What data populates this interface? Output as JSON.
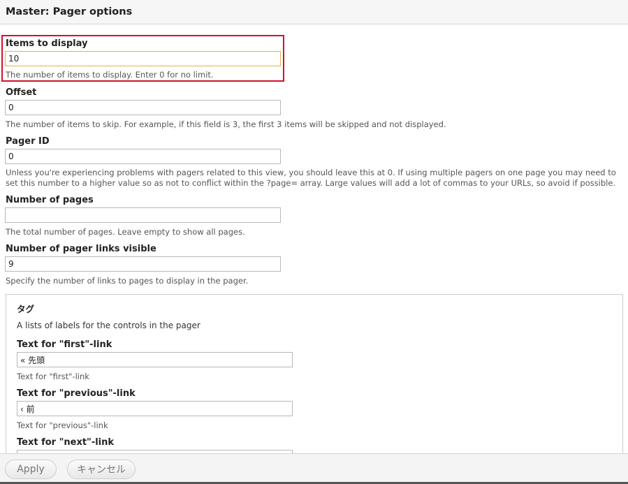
{
  "dialog": {
    "title": "Master: Pager options"
  },
  "fields": {
    "items_to_display": {
      "label": "Items to display",
      "value": "10",
      "description": "The number of items to display. Enter 0 for no limit."
    },
    "offset": {
      "label": "Offset",
      "value": "0",
      "description": "The number of items to skip. For example, if this field is 3, the first 3 items will be skipped and not displayed."
    },
    "pager_id": {
      "label": "Pager ID",
      "value": "0",
      "description": "Unless you're experiencing problems with pagers related to this view, you should leave this at 0. If using multiple pagers on one page you may need to set this number to a higher value so as not to conflict within the ?page= array. Large values will add a lot of commas to your URLs, so avoid if possible."
    },
    "number_of_pages": {
      "label": "Number of pages",
      "value": "",
      "description": "The total number of pages. Leave empty to show all pages."
    },
    "pager_links_visible": {
      "label": "Number of pager links visible",
      "value": "9",
      "description": "Specify the number of links to pages to display in the pager."
    }
  },
  "tags_fieldset": {
    "legend": "タグ",
    "description": "A lists of labels for the controls in the pager",
    "first": {
      "label": "Text for \"first\"-link",
      "value": "« 先頭",
      "description": "Text for \"first\"-link"
    },
    "previous": {
      "label": "Text for \"previous\"-link",
      "value": "‹ 前",
      "description": "Text for \"previous\"-link"
    },
    "next": {
      "label": "Text for \"next\"-link",
      "value": ""
    }
  },
  "footer": {
    "apply_label": "Apply",
    "cancel_label": "キャンセル"
  },
  "colors": {
    "highlight": "#d0112b",
    "focus_border": "#e0b34d"
  }
}
